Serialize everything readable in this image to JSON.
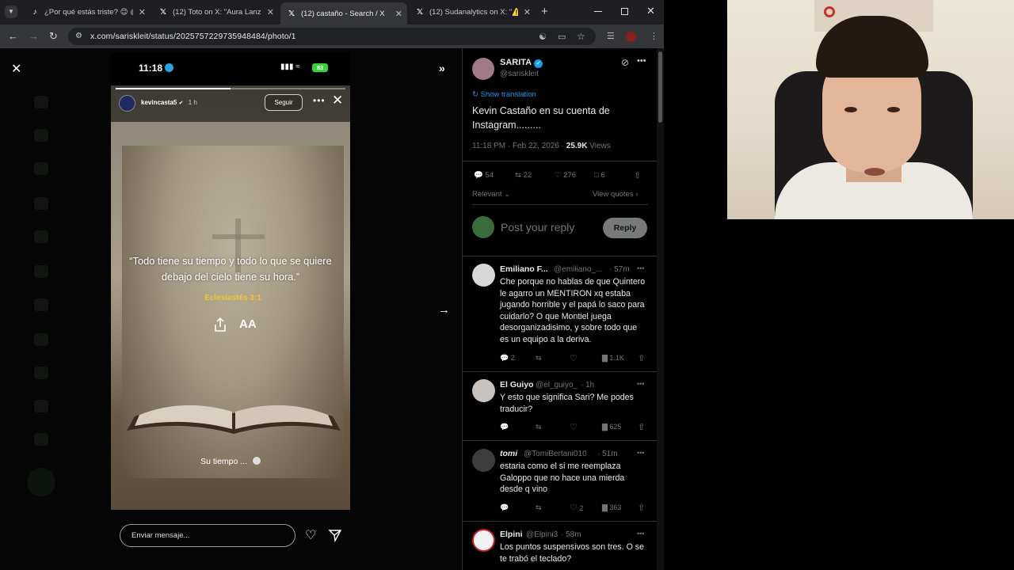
{
  "browser": {
    "tabs": [
      {
        "title": "¿Por qué estás triste? 😊 @",
        "icon": "tiktok-icon",
        "active": false
      },
      {
        "title": "(12) Toto on X: \"Aura Lanzin",
        "icon": "x-logo-icon",
        "active": false
      },
      {
        "title": "(12) castaño - Search / X",
        "icon": "x-logo-icon",
        "active": true
      },
      {
        "title": "(12) Sudanalytics on X: \"⚠️",
        "icon": "x-logo-icon",
        "active": false
      }
    ],
    "new_tab": "+",
    "url": "x.com/sariskleit/status/2025757229735948484/photo/1"
  },
  "story": {
    "time": "11:18",
    "battery": "83",
    "user": "kevincasta5",
    "age": "1 h",
    "follow_label": "Seguir",
    "quote": "“Todo tiene su tiempo y todo lo que se quiere debajo del cielo tiene su hora.”",
    "verse": "Eclesiastés 3:1",
    "aa_label": "AA",
    "music": "Su tiempo ...",
    "message_placeholder": "Enviar mensaje...",
    "progress": 0.5
  },
  "tweet": {
    "author_name": "SARITA",
    "author_handle": "@sariskleit",
    "show_translation": "Show translation",
    "text": "Kevin Castaño en su cuenta de Instagram.........",
    "time": "11:18 PM · Feb 22, 2026 ·",
    "views_count": "25.9K",
    "views_label": "Views",
    "replies": "54",
    "retweets": "22",
    "likes": "276",
    "bookmarks": "6",
    "sort_label": "Relevant",
    "view_quotes": "View quotes",
    "reply_placeholder": "Post your reply",
    "reply_button": "Reply"
  },
  "replies": [
    {
      "name": "Emiliano F...",
      "handle": "@emiliano_...",
      "time": "· 57m",
      "text": "Che porque no hablas de que Quintero le agarro un MENTIRON xq estaba jugando horrible y el papá lo saco para cuidarlo? O que Montiel juega desorganizadisimo, y sobre todo que es un equipo a la deriva.",
      "replies": "2",
      "retweets": "",
      "likes": "",
      "views": "1.1K"
    },
    {
      "name": "El Guiyo",
      "handle": "@el_guiyo_",
      "time": "· 1h",
      "text": "Y esto que significa Sari?  Me podes traducir?",
      "replies": "",
      "retweets": "",
      "likes": "",
      "views": "625"
    },
    {
      "name": "tomi",
      "handle": "@TomiBertani010",
      "time": "· 51m",
      "text": "estaria como el si me reemplaza Galoppo que no hace una mierda desde q vino",
      "replies": "",
      "retweets": "",
      "likes": "2",
      "views": "363"
    },
    {
      "name": "Elpini",
      "handle": "@Elpini3",
      "time": "· 58m",
      "text": "Los puntos suspensivos son tres. O se te trabó el teclado?",
      "replies": "",
      "retweets": "",
      "likes": "",
      "views": ""
    }
  ],
  "colors": {
    "x_blue": "#1d9bf0",
    "verse_gold": "#f3c431",
    "battery_green": "#3ad13a"
  }
}
